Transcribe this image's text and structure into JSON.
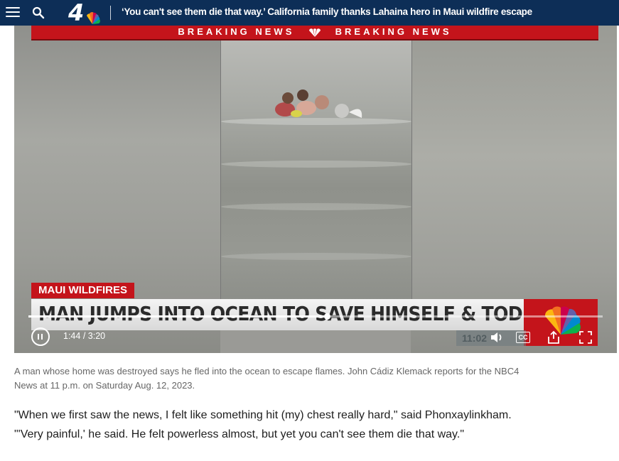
{
  "header": {
    "menu_icon": "hamburger-menu-icon",
    "search_icon": "search-icon",
    "logo_text": "4",
    "headline": "‘You can't see them die that way.’ California family thanks Lahaina hero in Maui wildfire escape",
    "background": "#0d2e57"
  },
  "video": {
    "breaking_left": "BREAKING NEWS",
    "breaking_right": "BREAKING NEWS",
    "tag": "MAUI WILDFIRES",
    "lower_third": "MAN JUMPS INTO OCEAN TO SAVE HIMSELF & TODDLER",
    "onscreen_clock": "11:02",
    "progress_fraction": 0.52,
    "current_time": "1:44",
    "separator": "/",
    "duration": "3:20",
    "cc_label": "CC",
    "accent": "#c4141b"
  },
  "caption": "A man whose home was destroyed says he fled into the ocean to escape flames. John Cádiz Klemack reports for the NBC4 News at 11 p.m. on Saturday Aug. 12, 2023.",
  "article": {
    "paragraph": "\"When we first saw the news, I felt like something hit (my) chest really hard,\" said Phonxaylinkham. \"'Very painful,' he said. He felt powerless almost, but yet you can't see them die that way.\""
  }
}
